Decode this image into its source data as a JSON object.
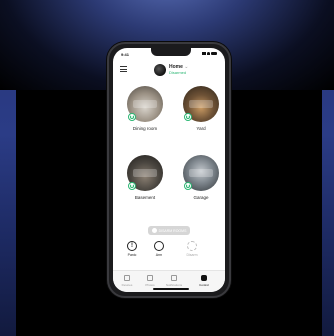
{
  "status": {
    "time": "9:41"
  },
  "header": {
    "home_title": "Home",
    "chevron": "⌄",
    "home_status": "Disarmed"
  },
  "rooms": [
    {
      "label": "Dining room"
    },
    {
      "label": "Yard"
    },
    {
      "label": "Basement"
    },
    {
      "label": "Garage"
    }
  ],
  "actions": {
    "arm_all": "DISARM ROOMS"
  },
  "modes": [
    {
      "label": "Panic",
      "glyph": "!"
    },
    {
      "label": "Arm",
      "glyph": ""
    },
    {
      "label": "Disarm",
      "glyph": ""
    }
  ],
  "tabs": [
    {
      "label": "Devices"
    },
    {
      "label": "Photos"
    },
    {
      "label": "Notifications"
    },
    {
      "label": "Control"
    }
  ],
  "colors": {
    "accent": "#2bb673",
    "background": "#000000"
  }
}
